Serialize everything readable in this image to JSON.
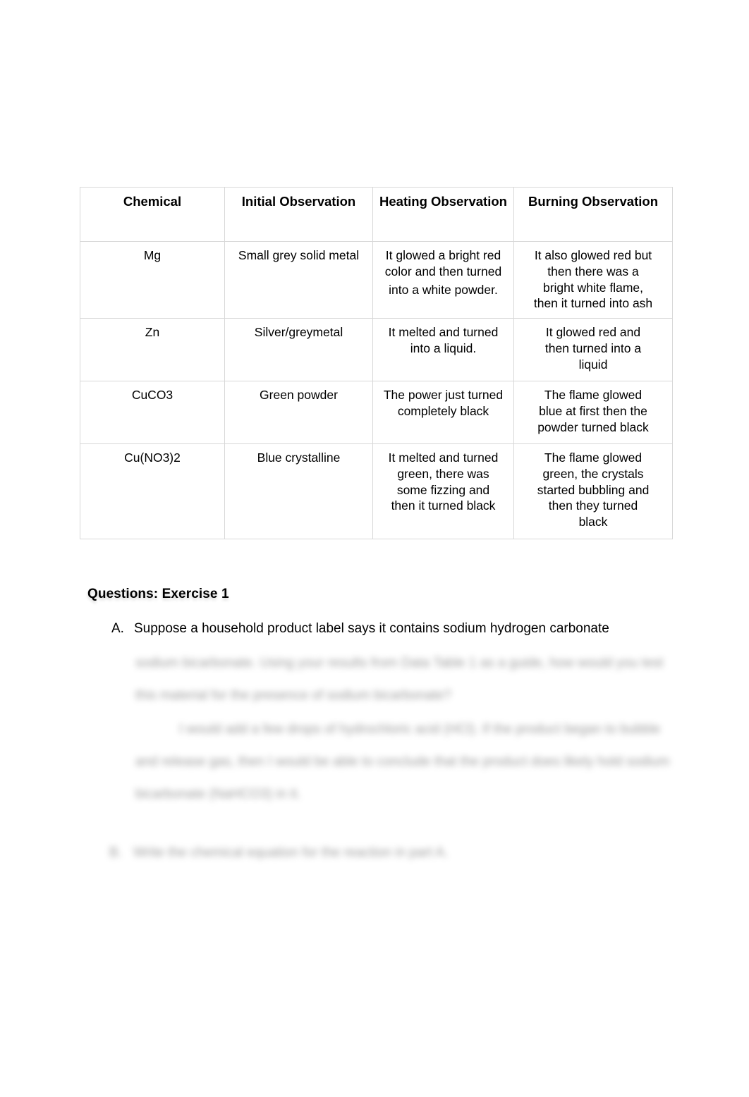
{
  "document": {
    "type": "lab-report-worksheet"
  },
  "table": {
    "name": "observation-table",
    "headers": [
      "Chemical",
      "Initial Observation",
      "Heating Observation",
      "Burning Observation"
    ],
    "rows": [
      {
        "chemical": "Mg",
        "initial": "Small grey solid metal",
        "heating_lines": [
          "It glowed a bright red",
          "color and then turned",
          "into a white powder."
        ],
        "burning_lines": [
          "It also glowed red but",
          "then there was a",
          "bright white flame,",
          "then it turned into ash"
        ]
      },
      {
        "chemical": "Zn",
        "initial": "Silver/greymetal",
        "heating_lines": [
          "It melted and turned",
          "into a liquid."
        ],
        "burning_lines": [
          "It glowed red and",
          "then turned into a",
          "liquid"
        ]
      },
      {
        "chemical": "CuCO3",
        "initial": "Green powder",
        "heating_lines": [
          "The power just turned",
          "completely black"
        ],
        "burning_lines": [
          "The flame glowed",
          "blue at first then the",
          "powder turned black"
        ]
      },
      {
        "chemical": "Cu(NO3)2",
        "initial": "Blue crystalline",
        "heating_lines": [
          "It melted and turned",
          "green, there was",
          "some fizzing and",
          "then it turned black"
        ],
        "burning_lines": [
          "The flame glowed",
          "green, the crystals",
          "started bubbling and",
          "then they turned",
          "black"
        ]
      }
    ]
  },
  "questions": {
    "heading": "Questions: Exercise 1",
    "item_a": {
      "marker": "A.",
      "text": "Suppose a household product label says it contains sodium hydrogen carbonate"
    },
    "redacted": {
      "paragraph_1": "sodium bicarbonate. Using your results from Data Table 1 as a guide, how would you test this material for the presence of sodium bicarbonate?",
      "paragraph_2": "I would add a few drops of hydrochloric acid (HCl). If the product began to bubble and release gas, then I would be able to conclude that the product does likely hold sodium bicarbonate (NaHCO3) in it.",
      "item_b_marker": "B.",
      "item_b_text": "Write the chemical equation for the reaction in part A."
    }
  }
}
